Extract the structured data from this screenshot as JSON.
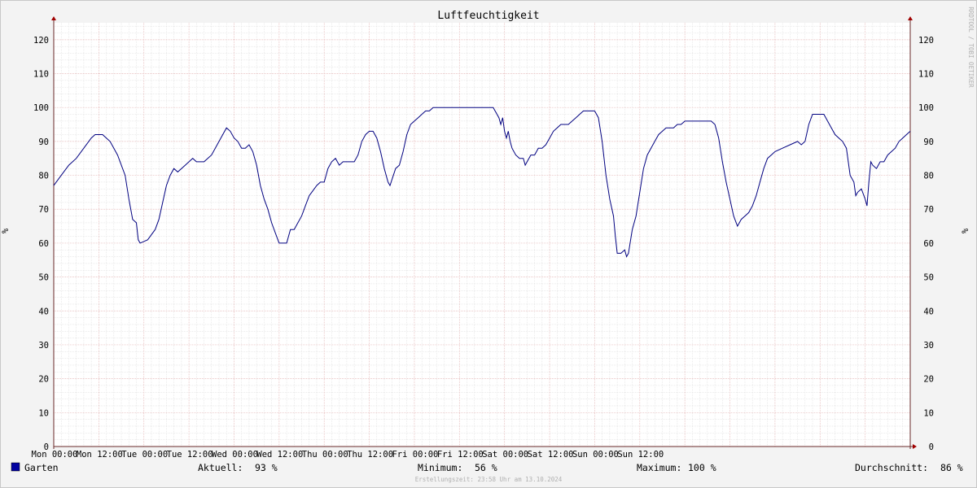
{
  "chart_data": {
    "type": "line",
    "title": "Luftfeuchtigkeit",
    "ylabel": "%",
    "ylim": [
      0,
      125
    ],
    "y_ticks": [
      0,
      10,
      20,
      30,
      40,
      50,
      60,
      70,
      80,
      90,
      100,
      110,
      120
    ],
    "x_tick_labels": [
      "Mon 00:00",
      "Mon 12:00",
      "Tue 00:00",
      "Tue 12:00",
      "Wed 00:00",
      "Wed 12:00",
      "Thu 00:00",
      "Thu 12:00",
      "Fri 00:00",
      "Fri 12:00",
      "Sat 00:00",
      "Sat 12:00",
      "Sun 00:00",
      "Sun 12:00"
    ],
    "x_unit": "hours since Mon 00:00",
    "xlim": [
      0,
      168
    ],
    "grid": true,
    "series": [
      {
        "name": "Garten",
        "color": "#000080",
        "points": [
          [
            0,
            77
          ],
          [
            2,
            80
          ],
          [
            4,
            83
          ],
          [
            6,
            85
          ],
          [
            8,
            88
          ],
          [
            10,
            91
          ],
          [
            11,
            92
          ],
          [
            13,
            92
          ],
          [
            15,
            90
          ],
          [
            17,
            86
          ],
          [
            19,
            80
          ],
          [
            20,
            73
          ],
          [
            21,
            67
          ],
          [
            22,
            66
          ],
          [
            22.5,
            61
          ],
          [
            23,
            60
          ],
          [
            25,
            61
          ],
          [
            27,
            64
          ],
          [
            28,
            67
          ],
          [
            29,
            72
          ],
          [
            30,
            77
          ],
          [
            31,
            80
          ],
          [
            32,
            82
          ],
          [
            33,
            81
          ],
          [
            35,
            83
          ],
          [
            36,
            84
          ],
          [
            37,
            85
          ],
          [
            38,
            84
          ],
          [
            40,
            84
          ],
          [
            42,
            86
          ],
          [
            43,
            88
          ],
          [
            45,
            92
          ],
          [
            46,
            94
          ],
          [
            47,
            93
          ],
          [
            48,
            91
          ],
          [
            49,
            90
          ],
          [
            50,
            88
          ],
          [
            51,
            88
          ],
          [
            52,
            89
          ],
          [
            53,
            87
          ],
          [
            54,
            83
          ],
          [
            55,
            77
          ],
          [
            56,
            73
          ],
          [
            57,
            70
          ],
          [
            58,
            66
          ],
          [
            59,
            63
          ],
          [
            60,
            60
          ],
          [
            62,
            60
          ],
          [
            63,
            64
          ],
          [
            64,
            64
          ],
          [
            65,
            66
          ],
          [
            66,
            68
          ],
          [
            67,
            71
          ],
          [
            68,
            74
          ],
          [
            70,
            77
          ],
          [
            71,
            78
          ],
          [
            72,
            78
          ],
          [
            73,
            82
          ],
          [
            74,
            84
          ],
          [
            75,
            85
          ],
          [
            76,
            83
          ],
          [
            77,
            84
          ],
          [
            80,
            84
          ],
          [
            81,
            86
          ],
          [
            82,
            90
          ],
          [
            83,
            92
          ],
          [
            84,
            93
          ],
          [
            85,
            93
          ],
          [
            86,
            91
          ],
          [
            87,
            87
          ],
          [
            88,
            82
          ],
          [
            89,
            78
          ],
          [
            89.5,
            77
          ],
          [
            91,
            82
          ],
          [
            92,
            83
          ],
          [
            93,
            87
          ],
          [
            94,
            92
          ],
          [
            95,
            95
          ],
          [
            96,
            96
          ],
          [
            97,
            97
          ],
          [
            98,
            98
          ],
          [
            99,
            99
          ],
          [
            100,
            99
          ],
          [
            101,
            100
          ],
          [
            105,
            100
          ],
          [
            112,
            100
          ],
          [
            117,
            100
          ],
          [
            117.5,
            99
          ],
          [
            118.5,
            97
          ],
          [
            119,
            95
          ],
          [
            119.5,
            97
          ],
          [
            120,
            93
          ],
          [
            120.5,
            91
          ],
          [
            121,
            93
          ],
          [
            121.5,
            90
          ],
          [
            122,
            88
          ],
          [
            123,
            86
          ],
          [
            124,
            85
          ],
          [
            125,
            85
          ],
          [
            125.5,
            83
          ],
          [
            126,
            84
          ],
          [
            127,
            86
          ],
          [
            128,
            86
          ],
          [
            129,
            88
          ],
          [
            130,
            88
          ],
          [
            131,
            89
          ],
          [
            132,
            91
          ],
          [
            133,
            93
          ],
          [
            134,
            94
          ],
          [
            135,
            95
          ],
          [
            137,
            95
          ],
          [
            138,
            96
          ],
          [
            139,
            97
          ],
          [
            140,
            98
          ],
          [
            141,
            99
          ],
          [
            142,
            99
          ],
          [
            144,
            99
          ],
          [
            145,
            97
          ],
          [
            146,
            90
          ],
          [
            147,
            80
          ],
          [
            148,
            73
          ],
          [
            149,
            68
          ],
          [
            149.5,
            62
          ],
          [
            150,
            57
          ],
          [
            151,
            57
          ],
          [
            152,
            58
          ],
          [
            152.5,
            56
          ],
          [
            153,
            57
          ],
          [
            154,
            64
          ],
          [
            155,
            68
          ],
          [
            156,
            75
          ],
          [
            157,
            82
          ],
          [
            158,
            86
          ],
          [
            159,
            88
          ],
          [
            160,
            90
          ],
          [
            161,
            92
          ],
          [
            162,
            93
          ],
          [
            163,
            94
          ],
          [
            165,
            94
          ],
          [
            166,
            95
          ],
          [
            167,
            95
          ],
          [
            168,
            96
          ],
          [
            170,
            96
          ],
          [
            173,
            96
          ],
          [
            175,
            96
          ],
          [
            176,
            95
          ],
          [
            177,
            91
          ],
          [
            178,
            84
          ],
          [
            179,
            78
          ],
          [
            180,
            73
          ],
          [
            181,
            68
          ],
          [
            182,
            65
          ],
          [
            183,
            67
          ],
          [
            184,
            68
          ],
          [
            185,
            69
          ],
          [
            186,
            71
          ],
          [
            187,
            74
          ],
          [
            188,
            78
          ],
          [
            189,
            82
          ],
          [
            190,
            85
          ],
          [
            191,
            86
          ],
          [
            192,
            87
          ],
          [
            194,
            88
          ],
          [
            196,
            89
          ],
          [
            198,
            90
          ],
          [
            199,
            89
          ],
          [
            200,
            90
          ],
          [
            201,
            95
          ],
          [
            202,
            98
          ],
          [
            205,
            98
          ],
          [
            206,
            96
          ],
          [
            207,
            94
          ],
          [
            208,
            92
          ],
          [
            209,
            91
          ],
          [
            210,
            90
          ],
          [
            211,
            88
          ],
          [
            211.5,
            84
          ],
          [
            212,
            80
          ],
          [
            213,
            78
          ],
          [
            213.5,
            74
          ],
          [
            214,
            75
          ],
          [
            215,
            76
          ],
          [
            216,
            73
          ],
          [
            216.5,
            71
          ],
          [
            217,
            78
          ],
          [
            217.5,
            84
          ],
          [
            218,
            83
          ],
          [
            219,
            82
          ],
          [
            220,
            84
          ],
          [
            221,
            84
          ],
          [
            222,
            86
          ],
          [
            223,
            87
          ],
          [
            224,
            88
          ],
          [
            225,
            90
          ],
          [
            226,
            91
          ],
          [
            227,
            92
          ],
          [
            228,
            93
          ]
        ]
      }
    ],
    "legend": {
      "series_label": "Garten",
      "aktuell_label": "Aktuell:",
      "aktuell_value": "93 %",
      "minimum_label": "Minimum:",
      "minimum_value": "56 %",
      "maximum_label": "Maximum:",
      "maximum_value": "100 %",
      "avg_label": "Durchschnitt:",
      "avg_value": "86 %"
    }
  },
  "footer": {
    "created": "Erstellungszeit: 23:58 Uhr am 13.10.2024",
    "watermark": "RRDTOOL / TOBI OETIKER"
  },
  "colors": {
    "major_grid": "#e3b3b3",
    "minor_grid": "#d8d8d8",
    "axis": "#6a2a2a",
    "series": "#000080"
  }
}
